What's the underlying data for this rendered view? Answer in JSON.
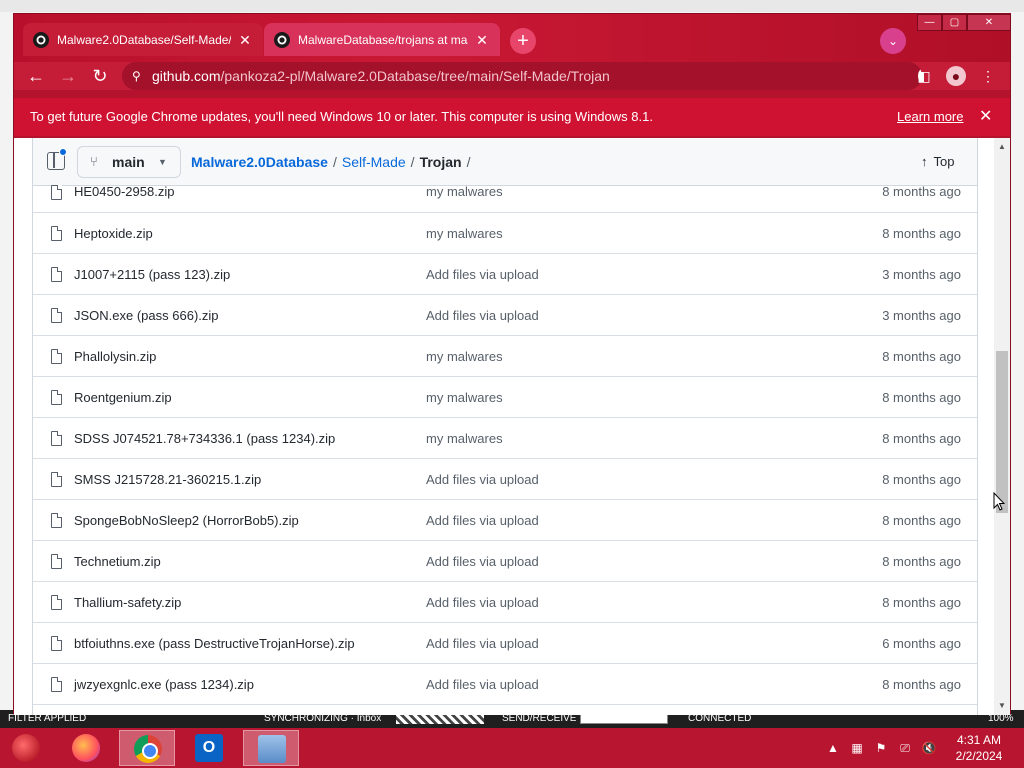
{
  "browser": {
    "tabs": [
      {
        "title": "Malware2.0Database/Self-Made/",
        "active": true
      },
      {
        "title": "MalwareDatabase/trojans at mas",
        "active": false
      }
    ],
    "new_tab": "+",
    "url_host": "github.com",
    "url_path": "/pankoza2-pl/Malware2.0Database/tree/main/Self-Made/Trojan",
    "accent_color": "#c51d38"
  },
  "infobar": {
    "message": "To get future Google Chrome updates, you'll need Windows 10 or later. This computer is using Windows 8.1.",
    "learn_more": "Learn more",
    "close": "✕"
  },
  "repo": {
    "branch": "main",
    "breadcrumb": {
      "repo": "Malware2.0Database",
      "folder": "Self-Made",
      "current": "Trojan",
      "sep": "/"
    },
    "top_label": "Top"
  },
  "files": [
    {
      "name": "HE0450-2958.zip",
      "commit": "my malwares",
      "age": "8 months ago"
    },
    {
      "name": "Heptoxide.zip",
      "commit": "my malwares",
      "age": "8 months ago"
    },
    {
      "name": "J1007+2115 (pass 123).zip",
      "commit": "Add files via upload",
      "age": "3 months ago"
    },
    {
      "name": "JSON.exe (pass 666).zip",
      "commit": "Add files via upload",
      "age": "3 months ago"
    },
    {
      "name": "Phallolysin.zip",
      "commit": "my malwares",
      "age": "8 months ago"
    },
    {
      "name": "Roentgenium.zip",
      "commit": "my malwares",
      "age": "8 months ago"
    },
    {
      "name": "SDSS J074521.78+734336.1 (pass 1234).zip",
      "commit": "my malwares",
      "age": "8 months ago"
    },
    {
      "name": "SMSS J215728.21-360215.1.zip",
      "commit": "Add files via upload",
      "age": "8 months ago"
    },
    {
      "name": "SpongeBobNoSleep2 (HorrorBob5).zip",
      "commit": "Add files via upload",
      "age": "8 months ago"
    },
    {
      "name": "Technetium.zip",
      "commit": "Add files via upload",
      "age": "8 months ago"
    },
    {
      "name": "Thallium-safety.zip",
      "commit": "Add files via upload",
      "age": "8 months ago"
    },
    {
      "name": "btfoiuthns.exe (pass DestructiveTrojanHorse).zip",
      "commit": "Add files via upload",
      "age": "6 months ago"
    },
    {
      "name": "jwzyexgnlc.exe (pass 1234).zip",
      "commit": "Add files via upload",
      "age": "8 months ago"
    }
  ],
  "outlook_status": {
    "filter": "FILTER APPLIED",
    "sync": "SYNCHRONIZING · Inbox",
    "send": "SEND/RECEIVE",
    "connected": "CONNECTED",
    "zoom": "100%"
  },
  "taskbar": {
    "time": "4:31 AM",
    "date": "2/2/2024",
    "outlook_glyph": "O"
  }
}
